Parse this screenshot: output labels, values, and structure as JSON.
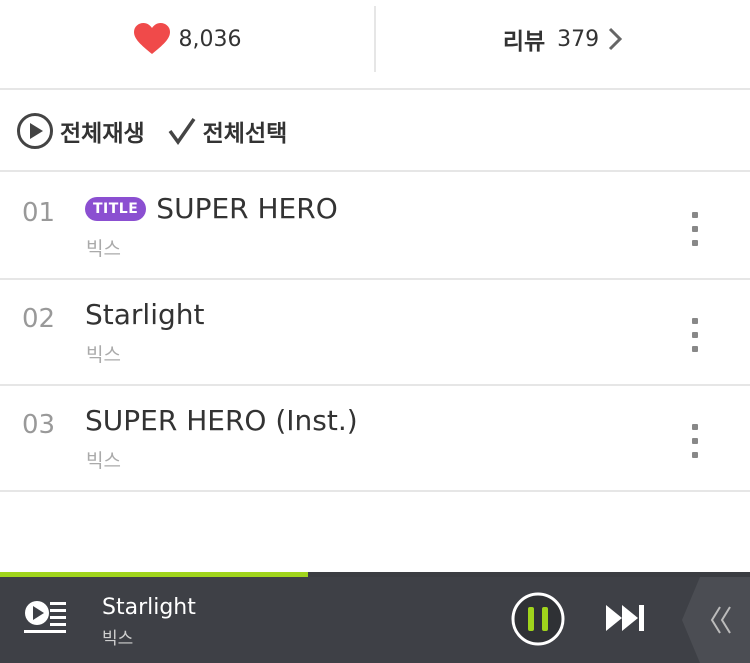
{
  "colors": {
    "heart": "#f04a4a",
    "accent_green": "#a0d41c",
    "title_badge": "#8b4fd1",
    "player_bg": "#3e4046"
  },
  "stats": {
    "likes": "8,036",
    "review_label": "리뷰",
    "review_count": "379"
  },
  "controls": {
    "play_all": "전체재생",
    "select_all": "전체선택"
  },
  "tracks": [
    {
      "number": "01",
      "badge": "TITLE",
      "title": "SUPER HERO",
      "artist": "빅스"
    },
    {
      "number": "02",
      "title": "Starlight",
      "artist": "빅스"
    },
    {
      "number": "03",
      "title": "SUPER HERO (Inst.)",
      "artist": "빅스"
    }
  ],
  "player": {
    "title": "Starlight",
    "artist": "빅스",
    "progress": 0.41
  }
}
